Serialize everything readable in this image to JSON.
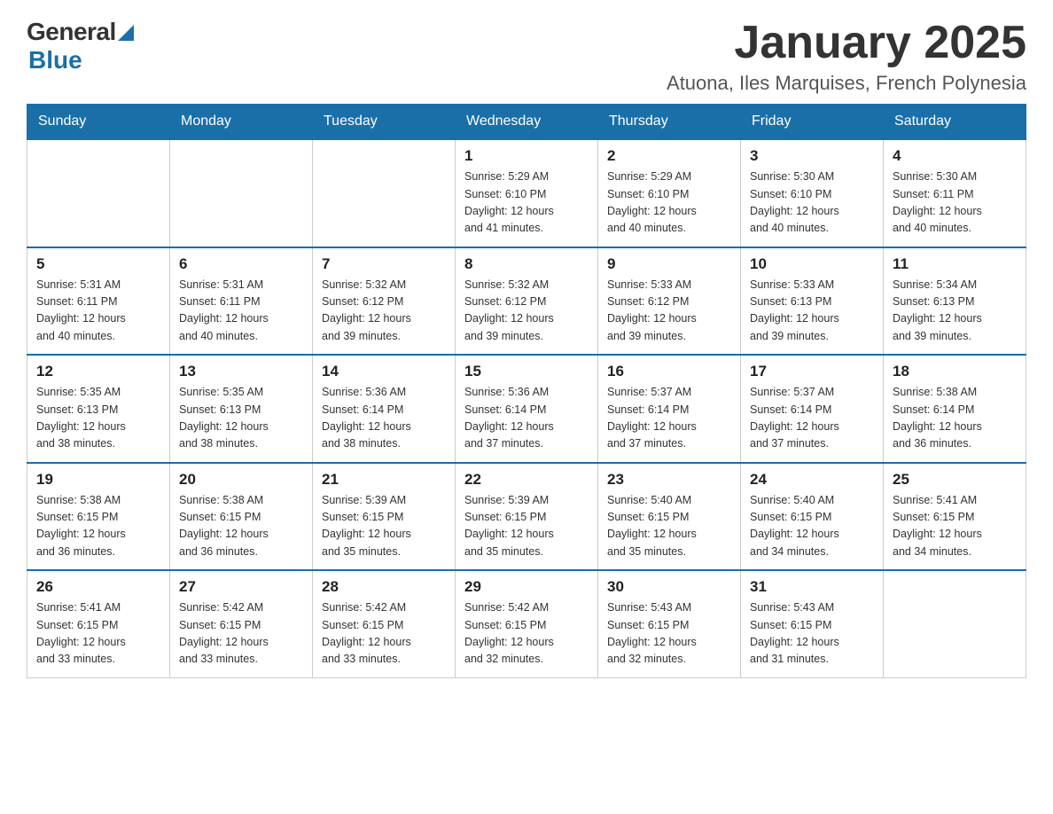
{
  "logo": {
    "general": "General",
    "blue": "Blue",
    "subtitle": "Blue"
  },
  "header": {
    "month": "January 2025",
    "location": "Atuona, Iles Marquises, French Polynesia"
  },
  "weekdays": [
    "Sunday",
    "Monday",
    "Tuesday",
    "Wednesday",
    "Thursday",
    "Friday",
    "Saturday"
  ],
  "weeks": [
    [
      {
        "day": "",
        "info": ""
      },
      {
        "day": "",
        "info": ""
      },
      {
        "day": "",
        "info": ""
      },
      {
        "day": "1",
        "info": "Sunrise: 5:29 AM\nSunset: 6:10 PM\nDaylight: 12 hours\nand 41 minutes."
      },
      {
        "day": "2",
        "info": "Sunrise: 5:29 AM\nSunset: 6:10 PM\nDaylight: 12 hours\nand 40 minutes."
      },
      {
        "day": "3",
        "info": "Sunrise: 5:30 AM\nSunset: 6:10 PM\nDaylight: 12 hours\nand 40 minutes."
      },
      {
        "day": "4",
        "info": "Sunrise: 5:30 AM\nSunset: 6:11 PM\nDaylight: 12 hours\nand 40 minutes."
      }
    ],
    [
      {
        "day": "5",
        "info": "Sunrise: 5:31 AM\nSunset: 6:11 PM\nDaylight: 12 hours\nand 40 minutes."
      },
      {
        "day": "6",
        "info": "Sunrise: 5:31 AM\nSunset: 6:11 PM\nDaylight: 12 hours\nand 40 minutes."
      },
      {
        "day": "7",
        "info": "Sunrise: 5:32 AM\nSunset: 6:12 PM\nDaylight: 12 hours\nand 39 minutes."
      },
      {
        "day": "8",
        "info": "Sunrise: 5:32 AM\nSunset: 6:12 PM\nDaylight: 12 hours\nand 39 minutes."
      },
      {
        "day": "9",
        "info": "Sunrise: 5:33 AM\nSunset: 6:12 PM\nDaylight: 12 hours\nand 39 minutes."
      },
      {
        "day": "10",
        "info": "Sunrise: 5:33 AM\nSunset: 6:13 PM\nDaylight: 12 hours\nand 39 minutes."
      },
      {
        "day": "11",
        "info": "Sunrise: 5:34 AM\nSunset: 6:13 PM\nDaylight: 12 hours\nand 39 minutes."
      }
    ],
    [
      {
        "day": "12",
        "info": "Sunrise: 5:35 AM\nSunset: 6:13 PM\nDaylight: 12 hours\nand 38 minutes."
      },
      {
        "day": "13",
        "info": "Sunrise: 5:35 AM\nSunset: 6:13 PM\nDaylight: 12 hours\nand 38 minutes."
      },
      {
        "day": "14",
        "info": "Sunrise: 5:36 AM\nSunset: 6:14 PM\nDaylight: 12 hours\nand 38 minutes."
      },
      {
        "day": "15",
        "info": "Sunrise: 5:36 AM\nSunset: 6:14 PM\nDaylight: 12 hours\nand 37 minutes."
      },
      {
        "day": "16",
        "info": "Sunrise: 5:37 AM\nSunset: 6:14 PM\nDaylight: 12 hours\nand 37 minutes."
      },
      {
        "day": "17",
        "info": "Sunrise: 5:37 AM\nSunset: 6:14 PM\nDaylight: 12 hours\nand 37 minutes."
      },
      {
        "day": "18",
        "info": "Sunrise: 5:38 AM\nSunset: 6:14 PM\nDaylight: 12 hours\nand 36 minutes."
      }
    ],
    [
      {
        "day": "19",
        "info": "Sunrise: 5:38 AM\nSunset: 6:15 PM\nDaylight: 12 hours\nand 36 minutes."
      },
      {
        "day": "20",
        "info": "Sunrise: 5:38 AM\nSunset: 6:15 PM\nDaylight: 12 hours\nand 36 minutes."
      },
      {
        "day": "21",
        "info": "Sunrise: 5:39 AM\nSunset: 6:15 PM\nDaylight: 12 hours\nand 35 minutes."
      },
      {
        "day": "22",
        "info": "Sunrise: 5:39 AM\nSunset: 6:15 PM\nDaylight: 12 hours\nand 35 minutes."
      },
      {
        "day": "23",
        "info": "Sunrise: 5:40 AM\nSunset: 6:15 PM\nDaylight: 12 hours\nand 35 minutes."
      },
      {
        "day": "24",
        "info": "Sunrise: 5:40 AM\nSunset: 6:15 PM\nDaylight: 12 hours\nand 34 minutes."
      },
      {
        "day": "25",
        "info": "Sunrise: 5:41 AM\nSunset: 6:15 PM\nDaylight: 12 hours\nand 34 minutes."
      }
    ],
    [
      {
        "day": "26",
        "info": "Sunrise: 5:41 AM\nSunset: 6:15 PM\nDaylight: 12 hours\nand 33 minutes."
      },
      {
        "day": "27",
        "info": "Sunrise: 5:42 AM\nSunset: 6:15 PM\nDaylight: 12 hours\nand 33 minutes."
      },
      {
        "day": "28",
        "info": "Sunrise: 5:42 AM\nSunset: 6:15 PM\nDaylight: 12 hours\nand 33 minutes."
      },
      {
        "day": "29",
        "info": "Sunrise: 5:42 AM\nSunset: 6:15 PM\nDaylight: 12 hours\nand 32 minutes."
      },
      {
        "day": "30",
        "info": "Sunrise: 5:43 AM\nSunset: 6:15 PM\nDaylight: 12 hours\nand 32 minutes."
      },
      {
        "day": "31",
        "info": "Sunrise: 5:43 AM\nSunset: 6:15 PM\nDaylight: 12 hours\nand 31 minutes."
      },
      {
        "day": "",
        "info": ""
      }
    ]
  ]
}
